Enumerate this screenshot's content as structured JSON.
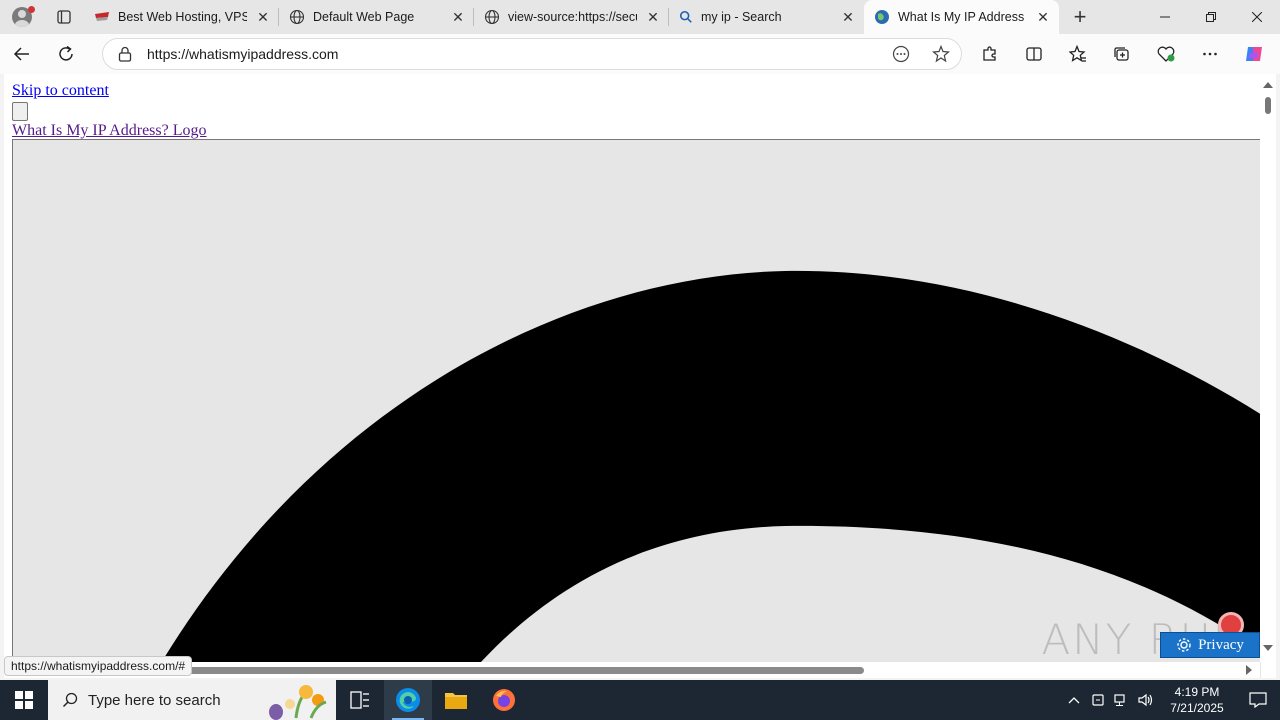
{
  "browser": {
    "tabs": [
      {
        "title": "Best Web Hosting, VPS, D",
        "active": false
      },
      {
        "title": "Default Web Page",
        "active": false
      },
      {
        "title": "view-source:https://secur",
        "active": false
      },
      {
        "title": "my ip - Search",
        "active": false
      },
      {
        "title": "What Is My IP Address - S",
        "active": true
      }
    ],
    "url": "https://whatismyipaddress.com",
    "status_url": "https://whatismyipaddress.com/#"
  },
  "page": {
    "skip_link": "Skip to content",
    "logo_alt": "What Is My IP Address? Logo",
    "privacy_button": "Privacy",
    "watermark": "ANY RUN"
  },
  "taskbar": {
    "search_placeholder": "Type here to search",
    "time": "4:19 PM",
    "date": "7/21/2025"
  },
  "colors": {
    "taskbar_bg": "#1c2733",
    "link": "#0000ee",
    "visited_link": "#551a8b",
    "privacy_bg": "#1a73c9"
  }
}
